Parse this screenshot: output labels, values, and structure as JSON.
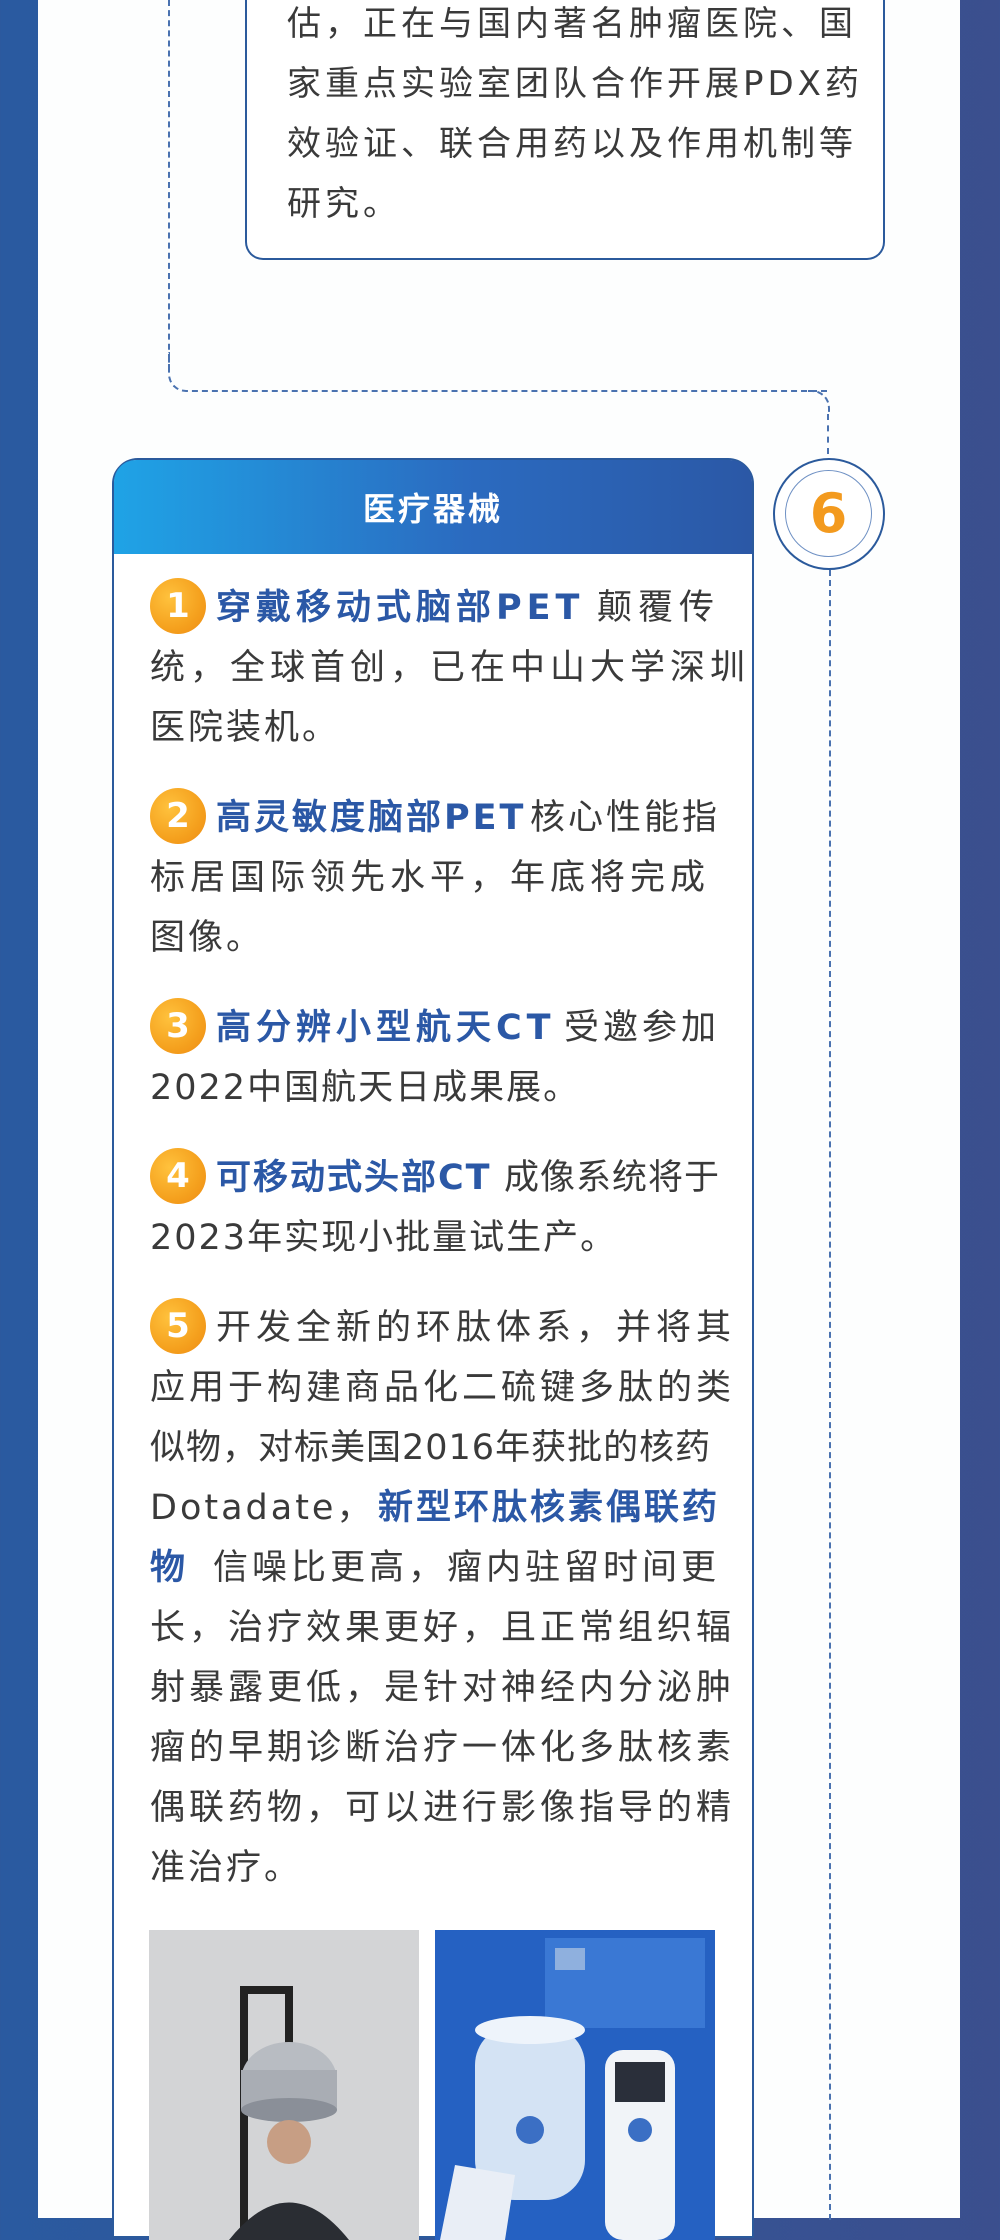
{
  "top_card": {
    "lines": [
      "估，正在与国内著名肿瘤医院、国",
      "家重点实验室团队合作开展PDX药",
      "效验证、联合用药以及作用机制等",
      "研究。"
    ]
  },
  "section": {
    "number": "6",
    "title": "医疗器械"
  },
  "items": [
    {
      "num": "1",
      "line1_hl": "穿戴移动式脑部PET",
      "line1_rest": "颠覆传",
      "line2": "统，全球首创，已在中山大学深圳",
      "line3": "医院装机。"
    },
    {
      "num": "2",
      "line1_hl": "高灵敏度脑部PET",
      "line1_rest": "核心性能指",
      "line2": "标居国际领先水平，年底将完成",
      "line3": "图像。"
    },
    {
      "num": "3",
      "line1_hl": "高分辨小型航天CT",
      "line1_rest": "受邀参加",
      "line2": "2022中国航天日成果展。"
    },
    {
      "num": "4",
      "line1_hl": "可移动式头部CT",
      "line1_rest": "成像系统将于",
      "line2": "2023年实现小批量试生产。"
    },
    {
      "num": "5",
      "lines": [
        "开发全新的环肽体系，并将其",
        "应用于构建商品化二硫键多肽的类",
        "似物，对标美国2016年获批的核药"
      ],
      "line4_pre": "Dotadate，",
      "line4_hl": "新型环肽核素偶联药",
      "line5_hl": "物",
      "line5_rest": "信噪比更高，瘤内驻留时间更",
      "lines_after": [
        "长，治疗效果更好，且正常组织辐",
        "射暴露更低，是针对神经内分泌肿",
        "瘤的早期诊断治疗一体化多肽核素",
        "偶联药物，可以进行影像指导的精"
      ],
      "last": "准治疗。"
    }
  ],
  "colors": {
    "primary": "#2b58a6",
    "accent": "#f5a11e",
    "header_start": "#1fa3e6",
    "text": "#3a3a3a"
  }
}
